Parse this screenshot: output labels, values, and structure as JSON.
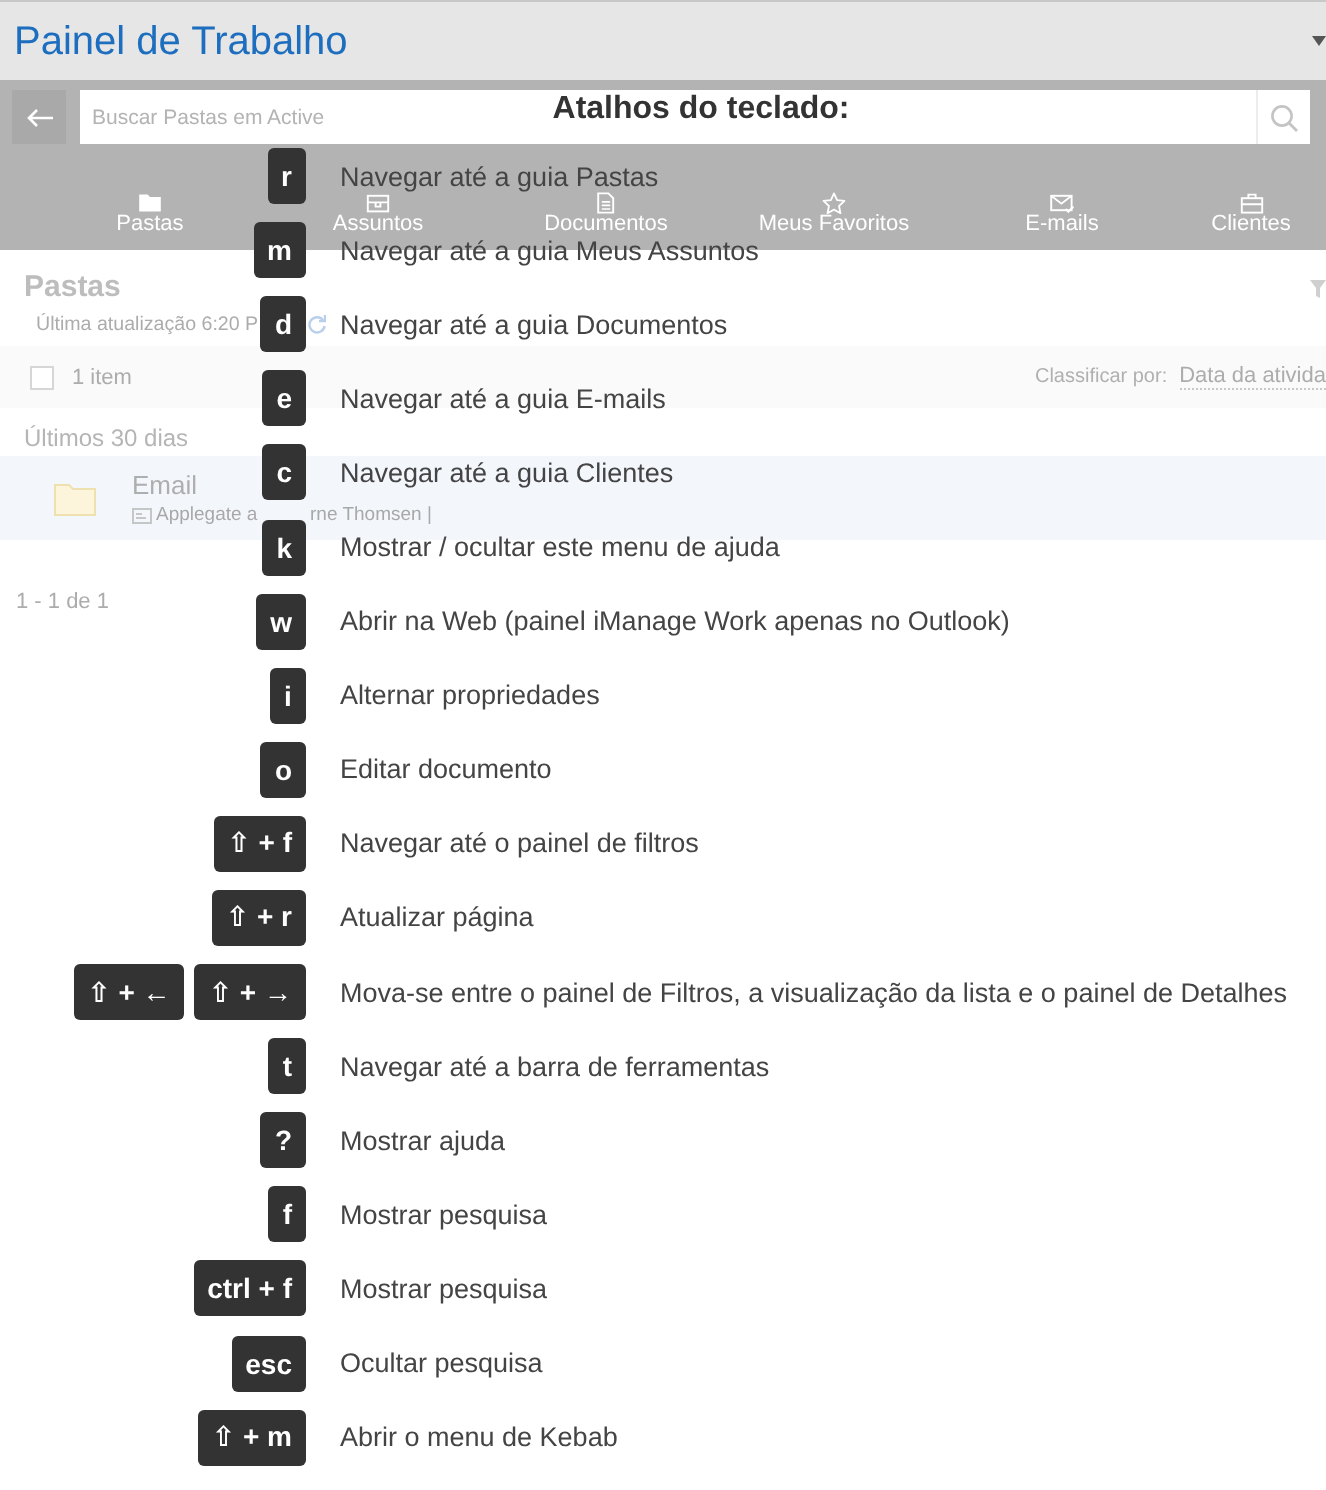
{
  "header": {
    "title": "Painel de Trabalho"
  },
  "toolbar": {
    "search": {
      "placeholder": "Buscar Pastas em Active"
    },
    "tabs": [
      {
        "label": "Pastas"
      },
      {
        "label": "Assuntos"
      },
      {
        "label": "Documentos"
      },
      {
        "label": "Meus Favoritos"
      },
      {
        "label": "E-mails"
      },
      {
        "label": "Clientes"
      }
    ]
  },
  "panel": {
    "title": "Pastas",
    "updated": "Última atualização 6:20 P",
    "list_bar": {
      "checked": false,
      "count": "1 item",
      "sort_label": "Classificar por:",
      "sort_value": "Data da ativida"
    },
    "group": "Últimos 30 dias",
    "rows": [
      {
        "name": "Email",
        "selected": true,
        "detail": [
          "Applegate a",
          "rne Thomsen |"
        ]
      }
    ],
    "pagination": "1 - 1 de 1"
  },
  "shortcuts": {
    "title": "Atalhos do teclado:",
    "items": [
      {
        "keys": [
          "r"
        ],
        "description": "Navegar até a guia Pastas"
      },
      {
        "keys": [
          "m"
        ],
        "description": "Navegar até a guia Meus Assuntos"
      },
      {
        "keys": [
          "d"
        ],
        "description": "Navegar até a guia Documentos"
      },
      {
        "keys": [
          "e"
        ],
        "description": "Navegar até a guia E-mails"
      },
      {
        "keys": [
          "c"
        ],
        "description": "Navegar até a guia Clientes"
      },
      {
        "keys": [
          "k"
        ],
        "description": "Mostrar / ocultar este menu de ajuda"
      },
      {
        "keys": [
          "w"
        ],
        "description": "Abrir na Web (painel iManage Work apenas no Outlook)"
      },
      {
        "keys": [
          "i"
        ],
        "description": "Alternar propriedades"
      },
      {
        "keys": [
          "o"
        ],
        "description": "Editar documento"
      },
      {
        "keys": [
          "⇧ + f"
        ],
        "description": "Navegar até o painel de filtros"
      },
      {
        "keys": [
          "⇧ + r"
        ],
        "description": "Atualizar página"
      },
      {
        "keys": [
          "⇧ + ←",
          "⇧ + →"
        ],
        "description": "Mova-se entre o painel de Filtros, a visualização da lista e o painel de Detalhes"
      },
      {
        "keys": [
          "t"
        ],
        "description": "Navegar até a barra de ferramentas"
      },
      {
        "keys": [
          "?"
        ],
        "description": "Mostrar ajuda"
      },
      {
        "keys": [
          "f"
        ],
        "description": "Mostrar pesquisa"
      },
      {
        "keys": [
          "ctrl + f"
        ],
        "description": "Mostrar pesquisa"
      },
      {
        "keys": [
          "esc"
        ],
        "description": "Ocultar pesquisa"
      },
      {
        "keys": [
          "⇧ + m"
        ],
        "description": "Abrir o menu de Kebab"
      }
    ]
  }
}
